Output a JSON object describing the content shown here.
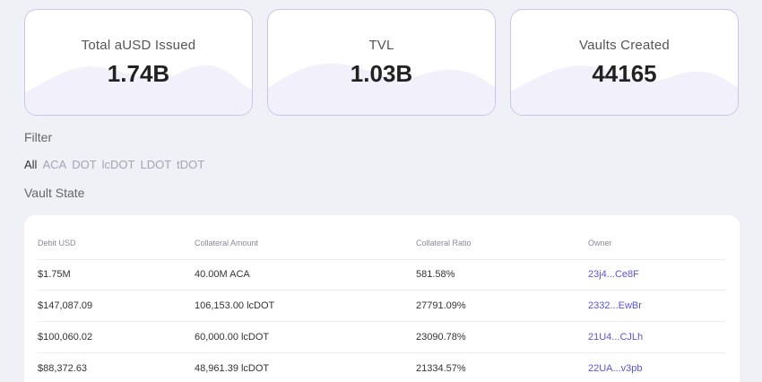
{
  "stats": [
    {
      "label": "Total aUSD Issued",
      "value": "1.74B"
    },
    {
      "label": "TVL",
      "value": "1.03B"
    },
    {
      "label": "Vaults Created",
      "value": "44165"
    }
  ],
  "filter": {
    "title": "Filter",
    "options": [
      "All",
      "ACA",
      "DOT",
      "lcDOT",
      "LDOT",
      "tDOT"
    ],
    "selected": "All"
  },
  "vault_state": {
    "title": "Vault State",
    "columns": [
      "Debit USD",
      "Collateral Amount",
      "Collateral Ratio",
      "Owner"
    ],
    "rows": [
      {
        "debit": "$1.75M",
        "collateral": "40.00M ACA",
        "ratio": "581.58%",
        "owner": "23j4...Ce8F"
      },
      {
        "debit": "$147,087.09",
        "collateral": "106,153.00 lcDOT",
        "ratio": "27791.09%",
        "owner": "2332...EwBr"
      },
      {
        "debit": "$100,060.02",
        "collateral": "60,000.00 lcDOT",
        "ratio": "23090.78%",
        "owner": "21U4...CJLh"
      },
      {
        "debit": "$88,372.63",
        "collateral": "48,961.39 lcDOT",
        "ratio": "21334.57%",
        "owner": "22UA...v3pb"
      }
    ]
  },
  "colors": {
    "accent": "#5a55d6",
    "card_border": "#c9c5ec",
    "wave": "#f1f0fb",
    "background": "#f0f1f6"
  }
}
